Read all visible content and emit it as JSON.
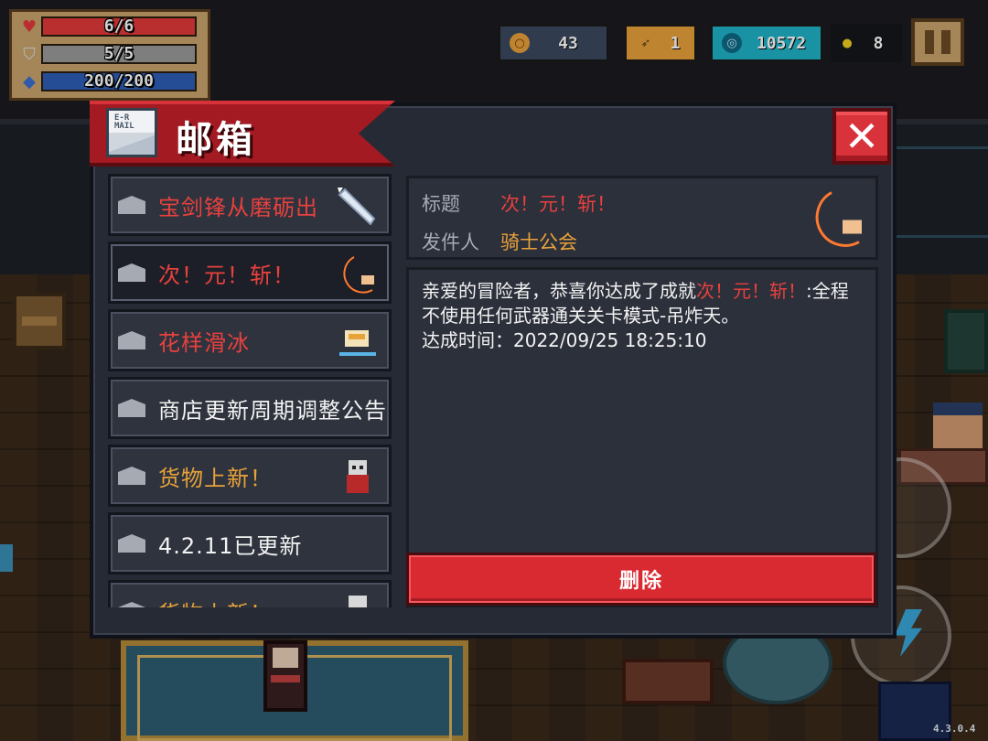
{
  "hud": {
    "hp": {
      "text": "6/6",
      "fill": 1.0,
      "color": "#e23a3a"
    },
    "armor": {
      "text": "5/5",
      "fill": 1.0,
      "color": "#9a9a9a"
    },
    "energy": {
      "text": "200/200",
      "fill": 1.0,
      "color": "#2c5fb6"
    },
    "gold": "43",
    "fish": "1",
    "gems": "10572",
    "seeds": "8",
    "version": "4.3.0.4"
  },
  "mailbox": {
    "title": "邮箱",
    "envelope_text": "E-R\nMAIL",
    "close_label": "✕",
    "items": [
      {
        "title": "宝剑锋从磨砺出",
        "color": "#e8413e",
        "thumb": "sword-icon"
      },
      {
        "title": "次！元！斩！",
        "color": "#e8413e",
        "thumb": "crescent-slash-icon"
      },
      {
        "title": "花样滑冰",
        "color": "#e8413e",
        "thumb": "skating-icon"
      },
      {
        "title": "商店更新周期调整公告",
        "color": "#f2f2f2",
        "thumb": ""
      },
      {
        "title": "货物上新！",
        "color": "#e8a23a",
        "thumb": "merchant-icon"
      },
      {
        "title": "4.2.11已更新",
        "color": "#f2f2f2",
        "thumb": ""
      },
      {
        "title": "货物上新！",
        "color": "#e8a23a",
        "thumb": "merchant-icon"
      }
    ],
    "detail": {
      "subject_label": "标题",
      "subject_value": "次！元！斩！",
      "sender_label": "发件人",
      "sender_value": "骑士公会",
      "body_prefix": "亲爱的冒险者，恭喜你达成了成就",
      "body_highlight": "次！元！斩！",
      "body_suffix": ":全程不使用任何武器通关关卡模式-吊炸天。",
      "time_line": "达成时间：2022/09/25 18:25:10",
      "delete_label": "删除"
    }
  },
  "colors": {
    "accent_red": "#d92a32",
    "highlight_red": "#e8413e",
    "orange": "#e8a23a",
    "panel_bg": "#262a34"
  }
}
